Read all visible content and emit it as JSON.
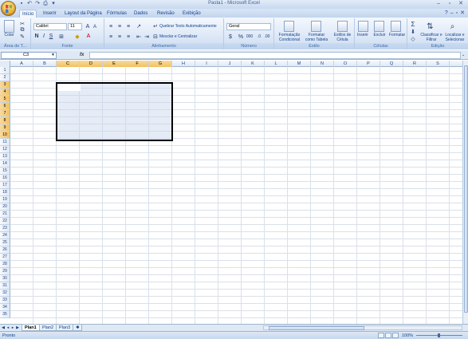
{
  "window": {
    "title": "Pasta1 - Microsoft Excel"
  },
  "tabs": [
    "Início",
    "Inserir",
    "Layout da Página",
    "Fórmulas",
    "Dados",
    "Revisão",
    "Exibição"
  ],
  "ribbon": {
    "clipboard": {
      "paste_label": "Colar",
      "group_label": "Área de T..."
    },
    "font": {
      "font_name": "Calibri",
      "font_size": "11",
      "group_label": "Fonte"
    },
    "alignment": {
      "wrap_label": "Quebrar Texto Automaticamente",
      "merge_label": "Mesclar e Centralizar",
      "group_label": "Alinhamento"
    },
    "number": {
      "format": "Geral",
      "group_label": "Número"
    },
    "styles": {
      "cond_label": "Formatação Condicional",
      "table_label": "Formatar como Tabela",
      "cell_styles_label": "Estilos de Célula",
      "group_label": "Estilo"
    },
    "cells": {
      "insert_label": "Inserir",
      "delete_label": "Excluir",
      "format_label": "Formatar",
      "group_label": "Células"
    },
    "editing": {
      "sort_label": "Classificar e Filtrar",
      "find_label": "Localizar e Selecionar",
      "group_label": "Edição"
    }
  },
  "formula_bar": {
    "name_box": "C3",
    "fx": "fx",
    "formula": ""
  },
  "columns": [
    "A",
    "B",
    "C",
    "D",
    "E",
    "F",
    "G",
    "H",
    "I",
    "J",
    "K",
    "L",
    "M",
    "N",
    "O",
    "P",
    "Q",
    "R",
    "S"
  ],
  "selected_columns": [
    "C",
    "D",
    "E",
    "F",
    "G"
  ],
  "rows": [
    "1",
    "2",
    "3",
    "4",
    "5",
    "6",
    "7",
    "8",
    "9",
    "10",
    "11",
    "12",
    "13",
    "14",
    "15",
    "16",
    "17",
    "18",
    "19",
    "20",
    "21",
    "22",
    "23",
    "24",
    "25",
    "26",
    "27",
    "28",
    "29",
    "30",
    "31",
    "32",
    "33",
    "34",
    "35"
  ],
  "selected_rows": [
    "3",
    "4",
    "5",
    "6",
    "7",
    "8",
    "9",
    "10"
  ],
  "sheets": [
    "Plan1",
    "Plan2",
    "Plan3"
  ],
  "active_sheet": "Plan1",
  "status": {
    "text": "Pronto",
    "zoom": "100%"
  }
}
